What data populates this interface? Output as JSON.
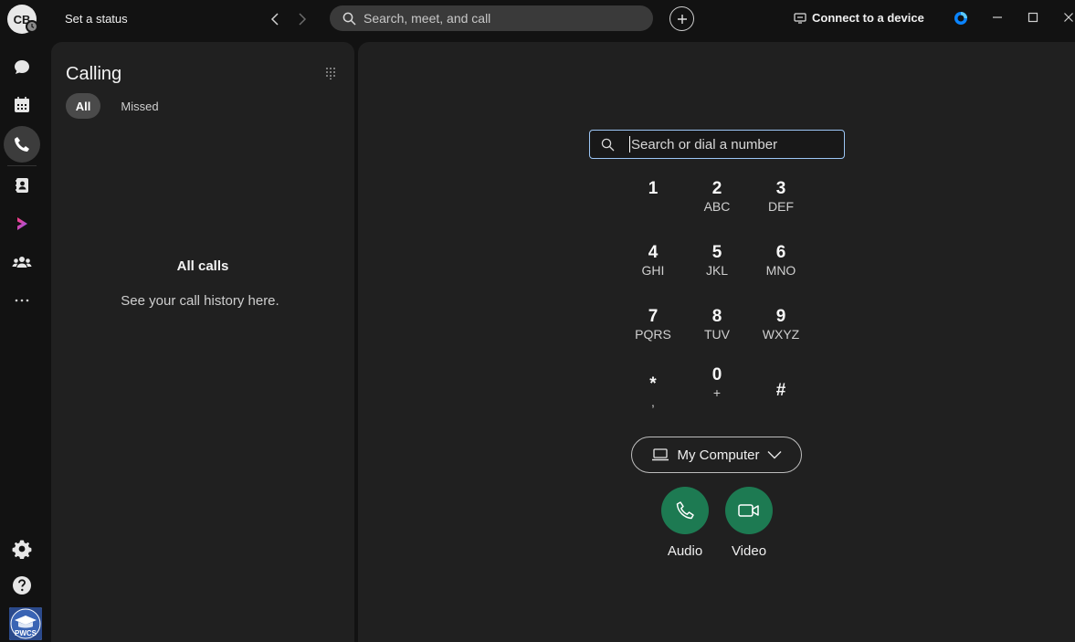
{
  "topbar": {
    "avatar_initials": "CB",
    "status_label": "Set a status",
    "search_placeholder": "Search, meet, and call",
    "connect_label": "Connect to a device"
  },
  "rail": {
    "items": [
      "messaging-icon",
      "calendar-icon",
      "calling-icon",
      "contacts-icon",
      "vidcast-icon",
      "teams-icon",
      "more-icon"
    ],
    "active": "calling-icon",
    "bottom": [
      "settings-icon",
      "help-icon"
    ],
    "org_logo_text": "PWCS"
  },
  "calling_panel": {
    "title": "Calling",
    "tabs": [
      {
        "label": "All",
        "selected": true
      },
      {
        "label": "Missed",
        "selected": false
      }
    ],
    "empty_title": "All calls",
    "empty_subtitle": "See your call history here."
  },
  "dialpad": {
    "input_placeholder": "Search or dial a number",
    "keys": [
      {
        "digit": "1",
        "letters": ""
      },
      {
        "digit": "2",
        "letters": "ABC"
      },
      {
        "digit": "3",
        "letters": "DEF"
      },
      {
        "digit": "4",
        "letters": "GHI"
      },
      {
        "digit": "5",
        "letters": "JKL"
      },
      {
        "digit": "6",
        "letters": "MNO"
      },
      {
        "digit": "7",
        "letters": "PQRS"
      },
      {
        "digit": "8",
        "letters": "TUV"
      },
      {
        "digit": "9",
        "letters": "WXYZ"
      },
      {
        "digit": "*",
        "letters": ","
      },
      {
        "digit": "0",
        "letters": "+"
      },
      {
        "digit": "#",
        "letters": ""
      }
    ],
    "device_label": "My Computer",
    "audio_label": "Audio",
    "video_label": "Video"
  },
  "colors": {
    "accent_green": "#1d7a52",
    "input_focus": "#9cc6f5",
    "webex_blue": "#0a84ff"
  }
}
